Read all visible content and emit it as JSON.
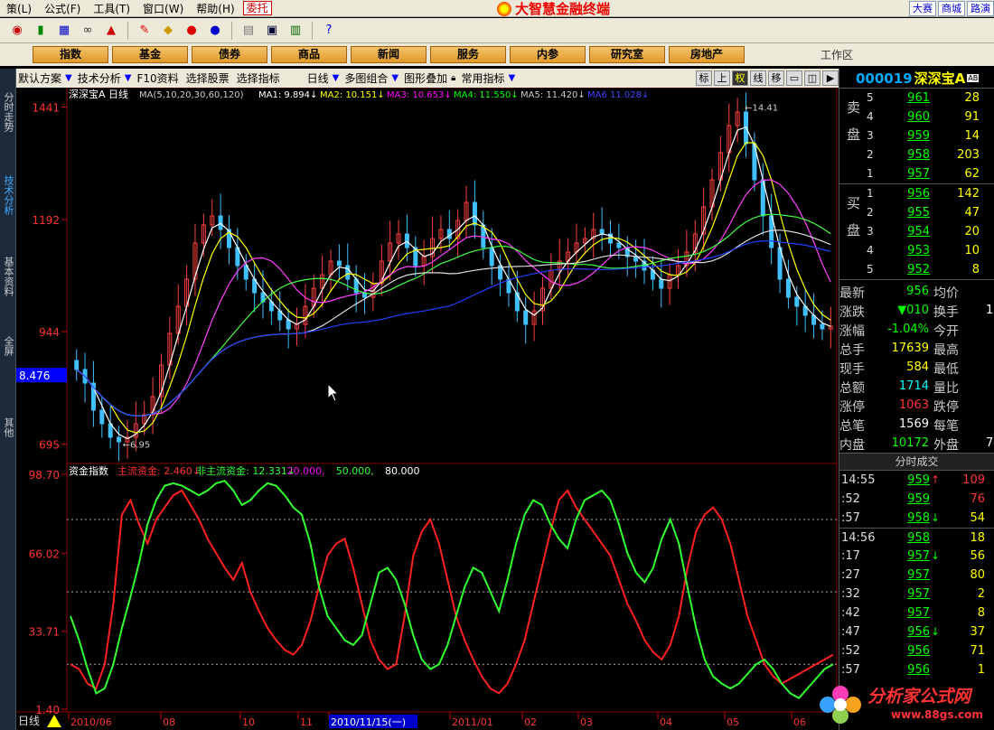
{
  "menu": {
    "items": [
      "策(L)",
      "公式(F)",
      "工具(T)",
      "窗口(W)",
      "帮助(H)"
    ],
    "entrust": "委托"
  },
  "app": {
    "title": "大智慧金融终端"
  },
  "top_tabs": [
    "大赛",
    "商城",
    "路演"
  ],
  "nav": {
    "buttons": [
      "指数",
      "基金",
      "债券",
      "商品",
      "新闻",
      "服务",
      "内参",
      "研究室",
      "房地产"
    ],
    "workspace": "工作区"
  },
  "left_tabs": [
    "分时走势",
    "技术分析",
    "基本资料",
    "全屏",
    "其他"
  ],
  "chart_toolbar": {
    "items": [
      "默认方案",
      "技术分析",
      "F10资料",
      "选择股票",
      "选择指标",
      "日线",
      "多图组合",
      "图形叠加",
      "常用指标"
    ],
    "icons": [
      "标",
      "上",
      "权",
      "线",
      "移"
    ]
  },
  "stock": {
    "code": "000019",
    "name": "深深宝A",
    "ab": "AB"
  },
  "order_book": {
    "sell_label": "卖盘",
    "buy_label": "买盘",
    "sells": [
      {
        "lv": "5",
        "price": "961",
        "vol": "28"
      },
      {
        "lv": "4",
        "price": "960",
        "vol": "91"
      },
      {
        "lv": "3",
        "price": "959",
        "vol": "14"
      },
      {
        "lv": "2",
        "price": "958",
        "vol": "203"
      },
      {
        "lv": "1",
        "price": "957",
        "vol": "62"
      }
    ],
    "buys": [
      {
        "lv": "1",
        "price": "956",
        "vol": "142"
      },
      {
        "lv": "2",
        "price": "955",
        "vol": "47"
      },
      {
        "lv": "3",
        "price": "954",
        "vol": "20"
      },
      {
        "lv": "4",
        "price": "953",
        "vol": "10"
      },
      {
        "lv": "5",
        "price": "952",
        "vol": "8"
      }
    ]
  },
  "stats": [
    {
      "k": "最新",
      "v": "956",
      "vc": "#0f0",
      "k2": "均价",
      "v2": ""
    },
    {
      "k": "涨跌",
      "v": "▼010",
      "vc": "#0f0",
      "k2": "换手",
      "v2": "1."
    },
    {
      "k": "涨幅",
      "v": "-1.04%",
      "vc": "#0f0",
      "k2": "今开",
      "v2": ""
    },
    {
      "k": "总手",
      "v": "17639",
      "vc": "#ff0",
      "k2": "最高",
      "v2": ""
    },
    {
      "k": "现手",
      "v": "584",
      "vc": "#ff0",
      "k2": "最低",
      "v2": ""
    },
    {
      "k": "总额",
      "v": "1714",
      "vc": "#0ff",
      "k2": "量比",
      "v2": ""
    },
    {
      "k": "涨停",
      "v": "1063",
      "vc": "#f33",
      "k2": "跌停",
      "v2": ""
    },
    {
      "k": "总笔",
      "v": "1569",
      "vc": "#fff",
      "k2": "每笔",
      "v2": ""
    },
    {
      "k": "内盘",
      "v": "10172",
      "vc": "#0f0",
      "k2": "外盘",
      "v2": "7"
    }
  ],
  "trades_title": "分时成交",
  "trades": [
    {
      "t": "14:55",
      "p": "959",
      "a": "↑",
      "ac": "#f33",
      "q": "109",
      "qc": "#f33",
      "sep": false
    },
    {
      "t": ":52",
      "p": "959",
      "a": "",
      "ac": "",
      "q": "76",
      "qc": "#f33",
      "sep": false
    },
    {
      "t": ":57",
      "p": "958",
      "a": "↓",
      "ac": "#0f0",
      "q": "54",
      "qc": "#ff0",
      "sep": false
    },
    {
      "t": "14:56",
      "p": "958",
      "a": "",
      "ac": "",
      "q": "18",
      "qc": "#ff0",
      "sep": true
    },
    {
      "t": ":17",
      "p": "957",
      "a": "↓",
      "ac": "#0f0",
      "q": "56",
      "qc": "#ff0",
      "sep": false
    },
    {
      "t": ":27",
      "p": "957",
      "a": "",
      "ac": "",
      "q": "80",
      "qc": "#ff0",
      "sep": false
    },
    {
      "t": ":32",
      "p": "957",
      "a": "",
      "ac": "",
      "q": "2",
      "qc": "#ff0",
      "sep": false
    },
    {
      "t": ":42",
      "p": "957",
      "a": "",
      "ac": "",
      "q": "8",
      "qc": "#ff0",
      "sep": false
    },
    {
      "t": ":47",
      "p": "956",
      "a": "↓",
      "ac": "#0f0",
      "q": "37",
      "qc": "#ff0",
      "sep": false
    },
    {
      "t": ":52",
      "p": "956",
      "a": "",
      "ac": "",
      "q": "71",
      "qc": "#ff0",
      "sep": false
    },
    {
      "t": ":57",
      "p": "956",
      "a": "",
      "ac": "",
      "q": "1",
      "qc": "#ff0",
      "sep": false
    }
  ],
  "watermark": {
    "text": "分析家公式网",
    "url": "www.88gs.com"
  },
  "chart_data": [
    {
      "type": "candlestick",
      "title": "深深宝A 日线",
      "legend": "MA(5,10,20,30,60,120)",
      "ma_labels": [
        {
          "name": "MA1:",
          "value": "9.894",
          "arrow": "↓",
          "color": "#ffffff"
        },
        {
          "name": "MA2:",
          "value": "10.151",
          "arrow": "↓",
          "color": "#ffff00"
        },
        {
          "name": "MA3:",
          "value": "10.653",
          "arrow": "↓",
          "color": "#ff00ff"
        },
        {
          "name": "MA4:",
          "value": "11.550",
          "arrow": "↓",
          "color": "#00ff00"
        },
        {
          "name": "MA5:",
          "value": "11.420",
          "arrow": "↓",
          "color": "#cccccc"
        },
        {
          "name": "MA6",
          "value": "11.028",
          "arrow": "↓",
          "color": "#4444ff"
        }
      ],
      "yticks": [
        "1441",
        "1192",
        "944",
        "695"
      ],
      "ylim": [
        6.6,
        14.6
      ],
      "cursor_label": "8.476",
      "high_label": "14.41",
      "low_label": "6.95",
      "x": [
        "2010/06",
        "08",
        "10",
        "11",
        "2010/11/15(一)",
        "2011/01",
        "02",
        "03",
        "04",
        "05",
        "06"
      ],
      "close": [
        8.6,
        8.3,
        7.7,
        7.4,
        7.1,
        7.0,
        7.1,
        7.4,
        7.6,
        8.0,
        8.7,
        9.4,
        10.0,
        10.6,
        11.4,
        11.8,
        12.0,
        11.7,
        11.3,
        10.9,
        10.6,
        10.3,
        10.1,
        9.9,
        9.7,
        9.5,
        9.6,
        10.0,
        10.4,
        10.7,
        11.0,
        10.9,
        10.6,
        10.3,
        10.2,
        10.5,
        11.0,
        11.4,
        11.6,
        11.3,
        10.9,
        11.1,
        11.5,
        11.7,
        11.5,
        11.9,
        12.3,
        11.8,
        11.3,
        10.9,
        10.6,
        10.3,
        9.9,
        9.6,
        9.9,
        10.4,
        10.8,
        11.0,
        11.2,
        11.4,
        11.5,
        11.7,
        11.6,
        11.4,
        11.3,
        11.1,
        11.0,
        10.8,
        10.6,
        10.4,
        10.7,
        10.9,
        11.2,
        11.6,
        12.2,
        12.8,
        13.4,
        14.0,
        14.3,
        13.6,
        12.8,
        12.0,
        11.3,
        10.6,
        10.2,
        10.0,
        9.8,
        9.6,
        9.5,
        9.56
      ]
    },
    {
      "type": "line",
      "title": "资金指数",
      "yticks": [
        "98.70",
        "66.02",
        "33.71",
        "1.40"
      ],
      "ylim": [
        1.4,
        98.7
      ],
      "dotted_levels": [
        20,
        50,
        80
      ],
      "labels": [
        {
          "text": "主流资金:",
          "value": "2.460",
          "arrow": "↓",
          "color": "#ff3030"
        },
        {
          "text": "非主流资金:",
          "value": "12.331",
          "arrow": "↓",
          "color": "#30ff30"
        },
        {
          "text": "",
          "value": "20.000,",
          "arrow": "",
          "color": "#ff00ff"
        },
        {
          "text": "",
          "value": "50.000,",
          "arrow": "",
          "color": "#30ff30"
        },
        {
          "text": "",
          "value": "80.000",
          "arrow": "",
          "color": "#ffffff"
        }
      ],
      "series": [
        {
          "name": "主流资金",
          "color": "#ff2020",
          "values": [
            20,
            18,
            12,
            10,
            20,
            45,
            82,
            88,
            78,
            70,
            80,
            85,
            90,
            92,
            86,
            80,
            72,
            66,
            60,
            55,
            62,
            50,
            42,
            35,
            30,
            26,
            24,
            28,
            38,
            52,
            65,
            70,
            72,
            60,
            45,
            30,
            22,
            18,
            20,
            40,
            65,
            75,
            80,
            70,
            55,
            40,
            30,
            22,
            15,
            10,
            8,
            12,
            20,
            30,
            45,
            60,
            75,
            88,
            92,
            85,
            80,
            75,
            70,
            65,
            55,
            45,
            38,
            30,
            25,
            22,
            28,
            40,
            60,
            75,
            82,
            85,
            80,
            70,
            55,
            40,
            30,
            20,
            15,
            12,
            14,
            16,
            18,
            20,
            22,
            24
          ]
        },
        {
          "name": "非主流资金",
          "color": "#30ff30",
          "values": [
            40,
            30,
            18,
            8,
            10,
            20,
            35,
            48,
            62,
            78,
            88,
            94,
            95,
            94,
            92,
            90,
            92,
            95,
            96,
            92,
            86,
            88,
            92,
            95,
            94,
            90,
            85,
            82,
            70,
            52,
            40,
            35,
            30,
            28,
            32,
            45,
            58,
            60,
            55,
            45,
            32,
            22,
            18,
            20,
            28,
            40,
            52,
            60,
            58,
            50,
            42,
            55,
            70,
            82,
            88,
            86,
            78,
            72,
            68,
            80,
            88,
            90,
            92,
            88,
            78,
            66,
            58,
            54,
            60,
            72,
            80,
            70,
            52,
            35,
            22,
            15,
            12,
            10,
            12,
            16,
            20,
            22,
            18,
            12,
            8,
            6,
            10,
            14,
            18,
            20
          ]
        }
      ]
    }
  ]
}
